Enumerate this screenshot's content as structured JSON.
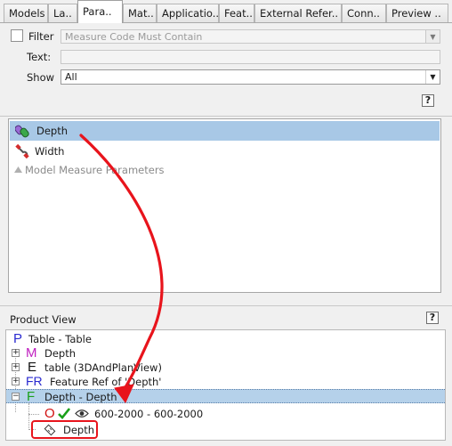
{
  "tabs": [
    {
      "label": "Models",
      "active": false
    },
    {
      "label": "La..",
      "active": false
    },
    {
      "label": "Para..",
      "active": true
    },
    {
      "label": "Mat..",
      "active": false
    },
    {
      "label": "Applicatio..",
      "active": false
    },
    {
      "label": "Feat..",
      "active": false
    },
    {
      "label": "External Refer..",
      "active": false
    },
    {
      "label": "Conn..",
      "active": false
    },
    {
      "label": "Preview ..",
      "active": false
    }
  ],
  "filter": {
    "checkbox_label": "Filter",
    "checked": false,
    "placeholder": "Measure Code Must Contain",
    "text_label": "Text:",
    "text_value": "",
    "show_label": "Show",
    "show_value": "All",
    "help": "?"
  },
  "parameters": {
    "items": [
      {
        "label": "Depth",
        "icon": "chain-link-icon",
        "selected": true
      },
      {
        "label": "Width",
        "icon": "magnet-icon",
        "selected": false
      }
    ],
    "group_label": "Model Measure Parameters"
  },
  "product_view": {
    "title": "Product View",
    "help": "?",
    "rows": [
      {
        "letter": "P",
        "letter_color": "#2a2ad0",
        "text": "Table - Table"
      },
      {
        "letter": "M",
        "letter_color": "#c020c0",
        "text": "Depth"
      },
      {
        "letter": "E",
        "letter_color": "#111111",
        "text": "table (3DAndPlanView)"
      },
      {
        "letter": "FR",
        "letter_color": "#2a2ad0",
        "text": "Feature Ref of 'Depth'"
      },
      {
        "letter": "F",
        "letter_color": "#1aa01a",
        "text": "Depth - Depth",
        "selected": true
      },
      {
        "letter": "O",
        "letter_color": "#d01010",
        "text": "600-2000 - 600-2000",
        "icons": [
          "check-icon",
          "eye-icon"
        ]
      },
      {
        "text": "Depth",
        "icon": "measure-tag-icon"
      }
    ]
  },
  "colors": {
    "selection": "#a8c8e6",
    "annotation": "#e8141c"
  }
}
